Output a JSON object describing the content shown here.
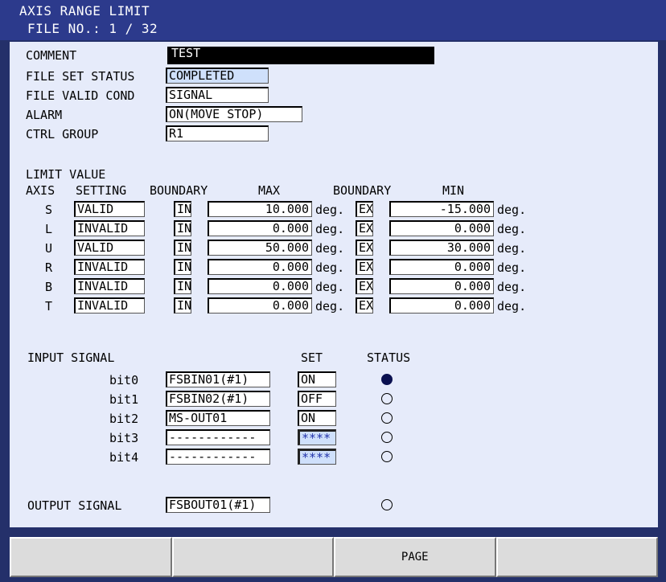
{
  "header": {
    "title": "AXIS RANGE LIMIT",
    "file_line": "FILE NO.:  1 / 32"
  },
  "settings": [
    {
      "label": "COMMENT",
      "value": "TEST"
    },
    {
      "label": "FILE SET STATUS",
      "value": "COMPLETED"
    },
    {
      "label": "FILE VALID COND",
      "value": "SIGNAL"
    },
    {
      "label": "ALARM",
      "value": "ON(MOVE STOP)"
    },
    {
      "label": "CTRL GROUP",
      "value": "R1"
    }
  ],
  "limit": {
    "section_title": "LIMIT VALUE",
    "headers": {
      "axis": "AXIS",
      "setting": "SETTING",
      "boundary_max": "BOUNDARY",
      "max": "MAX",
      "boundary_min": "BOUNDARY",
      "min": "MIN"
    },
    "unit": "deg.",
    "rows": [
      {
        "axis": "S",
        "setting": "VALID",
        "boundary_max": "IN",
        "max": "10.000",
        "boundary_min": "EX",
        "min": "-15.000"
      },
      {
        "axis": "L",
        "setting": "INVALID",
        "boundary_max": "IN",
        "max": "0.000",
        "boundary_min": "EX",
        "min": "0.000"
      },
      {
        "axis": "U",
        "setting": "VALID",
        "boundary_max": "IN",
        "max": "50.000",
        "boundary_min": "EX",
        "min": "30.000"
      },
      {
        "axis": "R",
        "setting": "INVALID",
        "boundary_max": "IN",
        "max": "0.000",
        "boundary_min": "EX",
        "min": "0.000"
      },
      {
        "axis": "B",
        "setting": "INVALID",
        "boundary_max": "IN",
        "max": "0.000",
        "boundary_min": "EX",
        "min": "0.000"
      },
      {
        "axis": "T",
        "setting": "INVALID",
        "boundary_max": "IN",
        "max": "0.000",
        "boundary_min": "EX",
        "min": "0.000"
      }
    ]
  },
  "input_signal": {
    "section_title": "INPUT SIGNAL",
    "set_header": "SET",
    "status_header": "STATUS",
    "bits": [
      {
        "bit": "bit0",
        "signal": "FSBIN01(#1)",
        "set": "ON",
        "status": "on"
      },
      {
        "bit": "bit1",
        "signal": "FSBIN02(#1)",
        "set": "OFF",
        "status": "off"
      },
      {
        "bit": "bit2",
        "signal": "MS-OUT01",
        "set": "ON",
        "status": "off"
      },
      {
        "bit": "bit3",
        "signal": "------------",
        "set": "****",
        "status": "off"
      },
      {
        "bit": "bit4",
        "signal": "------------",
        "set": "****",
        "status": "off"
      }
    ]
  },
  "output_signal": {
    "label": "OUTPUT SIGNAL",
    "signal": "FSBOUT01(#1)",
    "status": "off"
  },
  "footer": {
    "buttons": [
      "",
      "",
      "PAGE",
      ""
    ]
  },
  "colors": {
    "title_bar": "#2c3a8c",
    "panel_bg": "#e6ebfa",
    "highlight_field": "#cfe0fb",
    "status_on": "#0a1050"
  }
}
